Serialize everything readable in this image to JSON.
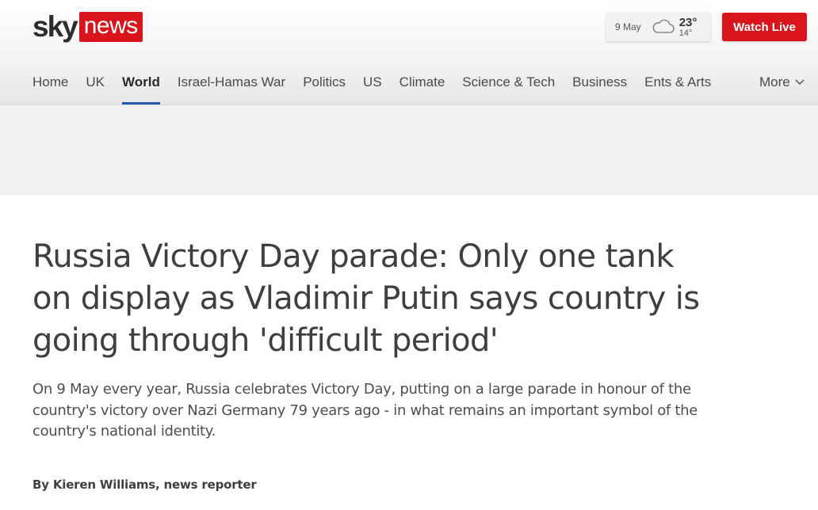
{
  "logo": {
    "sky": "sky",
    "news": "news"
  },
  "weather": {
    "date": "9 May",
    "icon": "cloud-icon",
    "high": "23°",
    "low": "14°"
  },
  "header": {
    "watch_live_label": "Watch Live"
  },
  "nav": {
    "items": [
      {
        "label": "Home",
        "active": false
      },
      {
        "label": "UK",
        "active": false
      },
      {
        "label": "World",
        "active": true
      },
      {
        "label": "Israel-Hamas War",
        "active": false
      },
      {
        "label": "Politics",
        "active": false
      },
      {
        "label": "US",
        "active": false
      },
      {
        "label": "Climate",
        "active": false
      },
      {
        "label": "Science & Tech",
        "active": false
      },
      {
        "label": "Business",
        "active": false
      },
      {
        "label": "Ents & Arts",
        "active": false
      }
    ],
    "more_label": "More"
  },
  "article": {
    "headline": "Russia Victory Day parade: Only one tank on display as Vladimir Putin says country is going through 'difficult period'",
    "standfirst": "On 9 May every year, Russia celebrates Victory Day, putting on a large parade in honour of the country's victory over Nazi Germany 79 years ago - in what remains an important symbol of the country's national identity.",
    "byline": "By Kieren Williams, news reporter"
  },
  "colors": {
    "brand_red": "#d9141c",
    "active_underline": "#2357a8"
  }
}
